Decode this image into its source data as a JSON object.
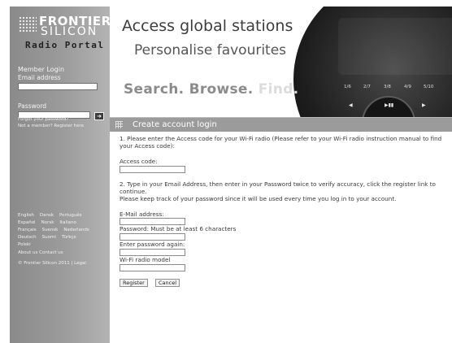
{
  "logo": {
    "line1": "FRONTIER",
    "line2": "SILICON",
    "line3": "Radio Portal"
  },
  "login": {
    "heading": "Member Login",
    "email_label": "Email address",
    "password_label": "Password",
    "go_label": "➜",
    "forgot": "Forgot your password?",
    "not_member": "Not a member? Register here"
  },
  "languages": [
    [
      "English",
      "Dansk",
      "Português"
    ],
    [
      "Español",
      "Norsk",
      "Italiano"
    ],
    [
      "Français",
      "Svensk",
      "Nederlands"
    ],
    [
      "Deutsch",
      "Suomi",
      "Türkçe"
    ],
    [
      "Polski"
    ]
  ],
  "footer": {
    "links": "About us   Contact us",
    "copyright": "© Frontier Silicon 2011 | Legal"
  },
  "banner": {
    "headline1": "Access global stations",
    "headline2": "Personalise favourites",
    "headline3_main": "Search. Browse.",
    "headline3_faint": "Find.",
    "presets": [
      "1/6",
      "2/7",
      "3/8",
      "4/9",
      "5/10"
    ],
    "controls": [
      "◀",
      "▶▮▮",
      "▶"
    ]
  },
  "section": {
    "title": "Create account login"
  },
  "form": {
    "step1_line1": "1. Please enter the Access code for your Wi-Fi radio (Please refer to your Wi-Fi radio instruction manual to find",
    "step1_line2": "your Access code):",
    "access_code_label": "Access code:",
    "step2_line1": "2. Type in your Email Address, then enter in your Password twice to verify accuracy, click the register link to",
    "step2_line2": "continue.",
    "step2_line3": "Please keep track of your password since it will be used every time you log in to your account.",
    "email_label": "E-Mail address:",
    "password_label": "Password: Must be at least 6 characters",
    "password_again_label": "Enter password again:",
    "model_label": "Wi-Fi radio model",
    "register_label": "Register",
    "cancel_label": "Cancel"
  }
}
